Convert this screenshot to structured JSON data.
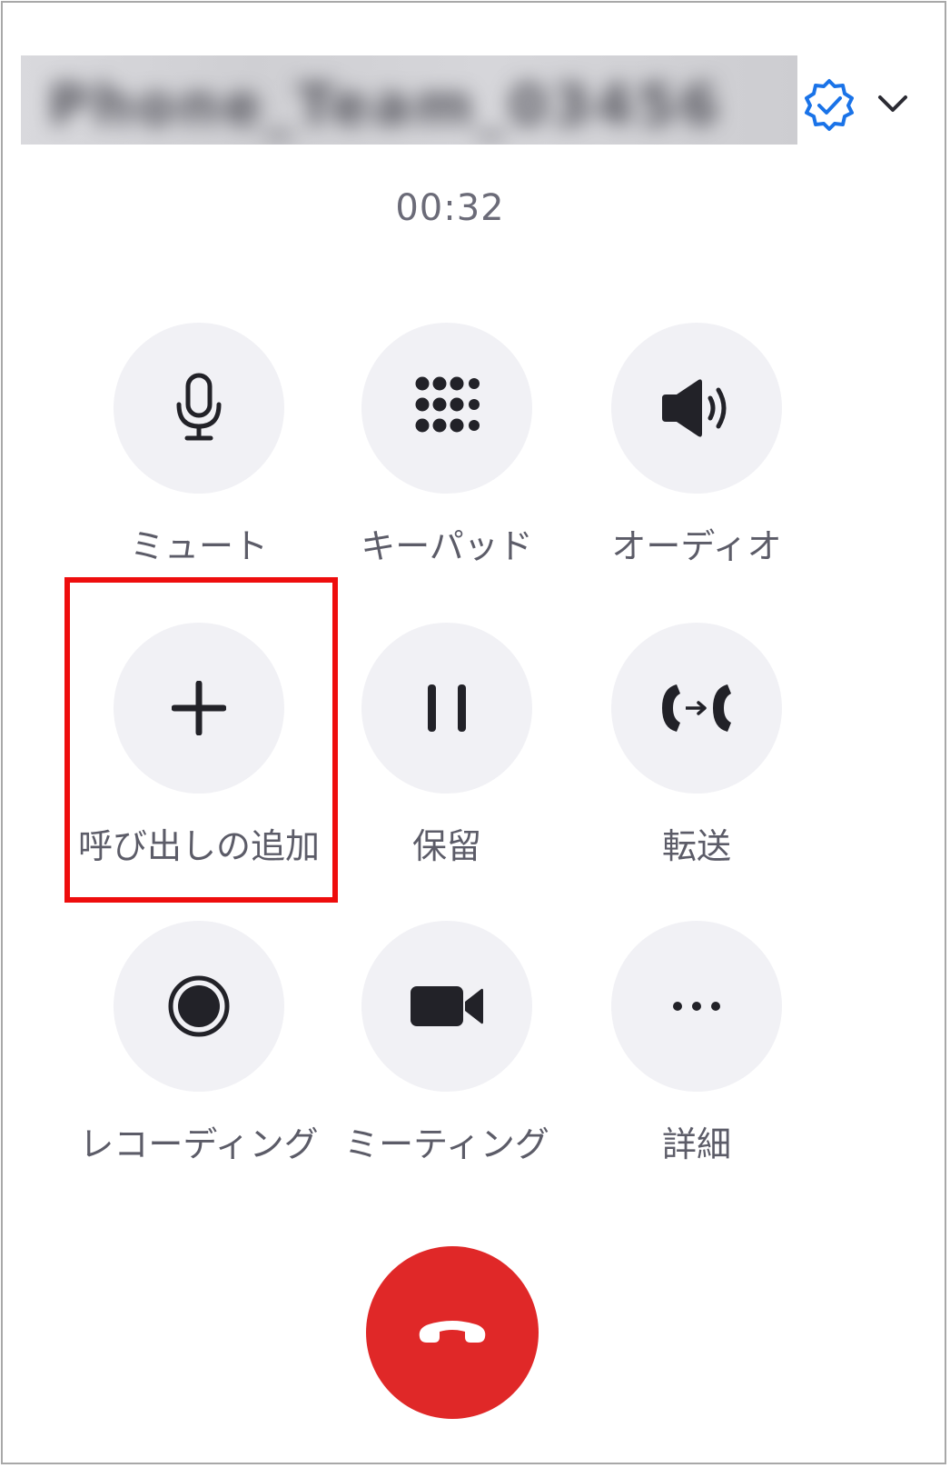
{
  "call": {
    "caller_name": "Phone_Team_03456",
    "timer": "00:32"
  },
  "colors": {
    "accent": "#1a73e8",
    "button_bg": "#f1f1f5",
    "end_call": "#e02828",
    "highlight": "#ee0d0d",
    "label": "#5c5c68"
  },
  "controls": [
    {
      "id": "mute",
      "label": "ミュート",
      "icon": "microphone-icon"
    },
    {
      "id": "keypad",
      "label": "キーパッド",
      "icon": "keypad-icon"
    },
    {
      "id": "audio",
      "label": "オーディオ",
      "icon": "speaker-icon"
    },
    {
      "id": "add_call",
      "label": "呼び出しの追加",
      "icon": "plus-icon",
      "highlighted": true
    },
    {
      "id": "hold",
      "label": "保留",
      "icon": "pause-icon"
    },
    {
      "id": "transfer",
      "label": "転送",
      "icon": "transfer-call-icon"
    },
    {
      "id": "recording",
      "label": "レコーディング",
      "icon": "record-icon"
    },
    {
      "id": "meeting",
      "label": "ミーティング",
      "icon": "video-camera-icon"
    },
    {
      "id": "more",
      "label": "詳細",
      "icon": "more-icon"
    }
  ],
  "end_call": {
    "icon": "hang-up-icon"
  },
  "header": {
    "verified_icon": "verified-badge-icon",
    "expand_icon": "chevron-down-icon"
  }
}
